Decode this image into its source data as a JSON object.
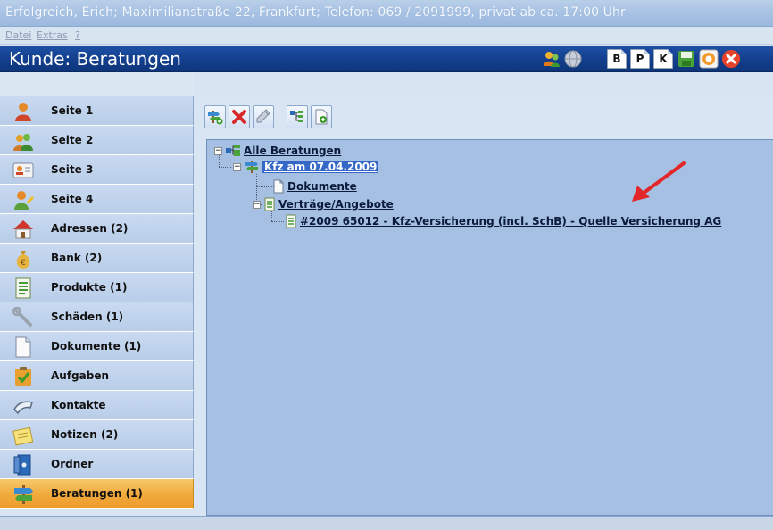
{
  "window": {
    "title": "Erfolgreich, Erich; Maximilianstraße 22, Frankfurt; Telefon: 069 / 2091999, privat ab ca. 17:00 Uhr"
  },
  "menu": {
    "items": [
      "Datei",
      "Extras",
      "?"
    ]
  },
  "header": {
    "title": "Kunde: Beratungen",
    "buttons": [
      {
        "icon": "users-icon"
      },
      {
        "icon": "globe-icon"
      },
      {
        "label": "B",
        "icon": "document-b-icon"
      },
      {
        "label": "P",
        "icon": "document-p-icon"
      },
      {
        "label": "K",
        "icon": "document-k-icon"
      },
      {
        "icon": "save-icon"
      },
      {
        "icon": "lifebuoy-icon"
      },
      {
        "icon": "close-icon"
      }
    ]
  },
  "sidebar": {
    "items": [
      {
        "label": "Seite 1",
        "icon": "person-icon"
      },
      {
        "label": "Seite 2",
        "icon": "people-icon"
      },
      {
        "label": "Seite 3",
        "icon": "contact-card-icon"
      },
      {
        "label": "Seite 4",
        "icon": "person-edit-icon"
      },
      {
        "label": "Adressen (2)",
        "icon": "house-icon"
      },
      {
        "label": "Bank (2)",
        "icon": "money-bag-icon"
      },
      {
        "label": "Produkte (1)",
        "icon": "document-list-icon"
      },
      {
        "label": "Schäden (1)",
        "icon": "wrench-icon"
      },
      {
        "label": "Dokumente (1)",
        "icon": "document-icon"
      },
      {
        "label": "Aufgaben",
        "icon": "clipboard-check-icon"
      },
      {
        "label": "Kontakte",
        "icon": "handshake-icon"
      },
      {
        "label": "Notizen (2)",
        "icon": "notes-icon"
      },
      {
        "label": "Ordner",
        "icon": "binder-icon"
      },
      {
        "label": "Beratungen (1)",
        "icon": "signpost-icon",
        "active": true
      }
    ]
  },
  "toolbar": {
    "buttons": [
      {
        "icon": "add-node-icon"
      },
      {
        "icon": "delete-icon"
      },
      {
        "icon": "edit-link-icon"
      },
      {
        "icon": "expand-tree-icon"
      },
      {
        "icon": "new-document-icon"
      }
    ]
  },
  "tree": {
    "root": "Alle Beratungen",
    "consultation": "Kfz am 07.04.2009",
    "documents": "Dokumente",
    "contracts": "Verträge/Angebote",
    "contract_item": "#2009 65012 - Kfz-Versicherung (incl. SchB) - Quelle Versicherung AG"
  },
  "colors": {
    "header_bg": "#133f8d",
    "active_nav": "#f1a93b",
    "tree_bg": "#a5c0e2",
    "selection": "#3568c6",
    "annotation_arrow": "#e2262a"
  }
}
